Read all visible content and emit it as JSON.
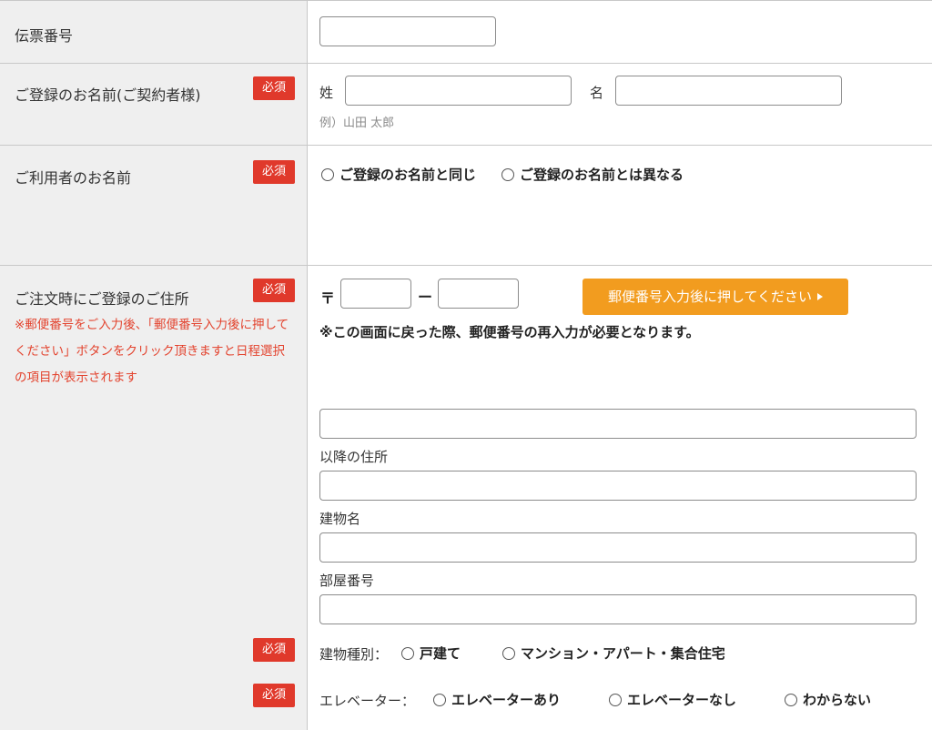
{
  "required_badge": "必須",
  "rows": {
    "slip": {
      "label": "伝票番号"
    },
    "registrant": {
      "label": "ご登録のお名前(ご契約者様)",
      "last_name_label": "姓",
      "first_name_label": "名",
      "example": "例）山田 太郎"
    },
    "user": {
      "label": "ご利用者のお名前",
      "option_same": "ご登録のお名前と同じ",
      "option_different": "ご登録のお名前とは異なる"
    },
    "address": {
      "label": "ご注文時にご登録のご住所",
      "note": "※郵便番号をご入力後、「郵便番号入力後に押してください」ボタンをクリック頂きますと日程選択の項目が表示されます",
      "postal_mark": "〒",
      "postal_dash": "ー",
      "lookup_button": "郵便番号入力後に押してください",
      "postal_warning": "※この画面に戻った際、郵便番号の再入力が必要となります。",
      "after_label": "以降の住所",
      "building_label": "建物名",
      "room_label": "部屋番号",
      "building_type": {
        "label": "建物種別：",
        "options": [
          "戸建て",
          "マンション・アパート・集合住宅"
        ]
      },
      "elevator": {
        "label": "エレベーター：",
        "options": [
          "エレベーターあり",
          "エレベーターなし",
          "わからない"
        ]
      }
    }
  },
  "colors": {
    "required": "#e0392b",
    "note": "#e3432e",
    "button": "#f29c1f",
    "label_bg": "#efefef"
  }
}
